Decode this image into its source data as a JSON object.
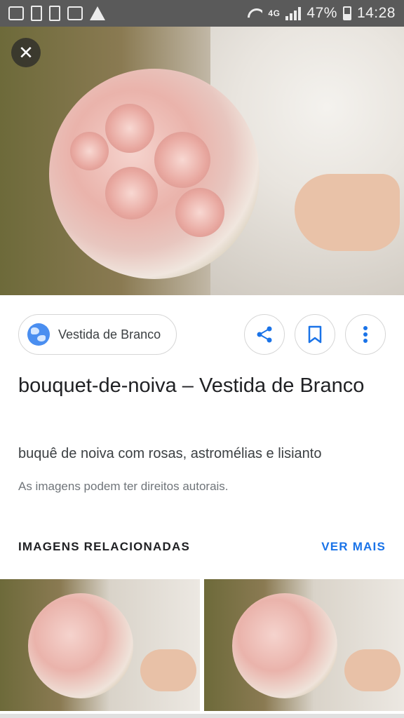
{
  "status_bar": {
    "network": "4G",
    "battery": "47%",
    "time": "14:28"
  },
  "viewer": {
    "close_icon": "close-icon",
    "image_description_icon": "bouquet-image"
  },
  "source": {
    "name": "Vestida de Branco",
    "icon": "globe-icon"
  },
  "actions": {
    "share_icon": "share-icon",
    "save_icon": "bookmark-icon",
    "more_icon": "more-vertical-icon"
  },
  "result": {
    "title": "bouquet-de-noiva – Vestida de Branco",
    "description": "buquê de noiva com rosas, astromélias e lisianto",
    "copyright_notice": "As imagens podem ter direitos autorais."
  },
  "related": {
    "heading": "IMAGENS RELACIONADAS",
    "see_more": "VER MAIS"
  },
  "colors": {
    "accent": "#1a73e8",
    "status_bar": "#5a5a5a"
  }
}
